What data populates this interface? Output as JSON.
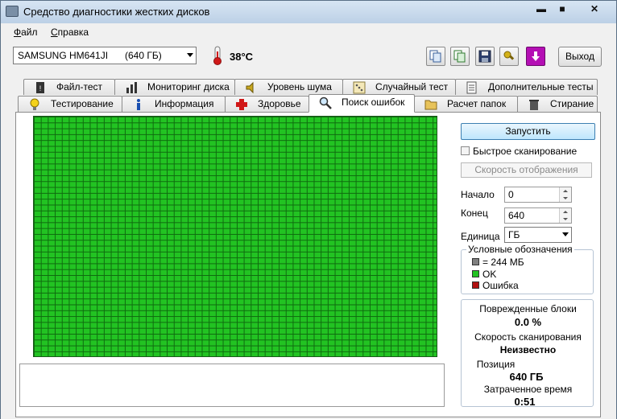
{
  "window": {
    "title": "Средство диагностики жестких дисков",
    "buttons": {
      "minimize": "▬",
      "maximize": "■",
      "close": "✕"
    }
  },
  "menu": {
    "file": {
      "accel": "Ф",
      "rest": "айл"
    },
    "help": {
      "accel": "С",
      "rest": "правка"
    }
  },
  "toolbar": {
    "disk_name": "SAMSUNG HM641JI",
    "disk_capacity": "(640 ГБ)",
    "temperature": "38°C",
    "exit_label": "Выход",
    "icons": [
      "copy-icon",
      "copy-report-icon",
      "save-icon",
      "tools-icon",
      "download-icon"
    ]
  },
  "tabs": {
    "top_row": [
      {
        "label": "Файл-тест",
        "icon": "file-test-icon"
      },
      {
        "label": "Мониторинг диска",
        "icon": "monitor-chart-icon"
      },
      {
        "label": "Уровень шума",
        "icon": "speaker-icon"
      },
      {
        "label": "Случайный тест",
        "icon": "random-test-icon"
      },
      {
        "label": "Дополнительные тесты",
        "icon": "extra-tests-icon"
      }
    ],
    "bottom_row": [
      {
        "label": "Тестирование",
        "icon": "bulb-icon"
      },
      {
        "label": "Информация",
        "icon": "info-icon"
      },
      {
        "label": "Здоровье",
        "icon": "health-cross-icon"
      },
      {
        "label": "Поиск ошибок",
        "icon": "magnifier-icon",
        "active": true
      },
      {
        "label": "Расчет папок",
        "icon": "folder-icon"
      },
      {
        "label": "Стирание",
        "icon": "trash-icon"
      }
    ]
  },
  "scan": {
    "start_label": "Запустить",
    "quick_scan_label": "Быстрое сканирование",
    "quick_scan_checked": false,
    "display_speed_label": "Скорость отображения",
    "start_field_label": "Начало",
    "start_value": "0",
    "end_field_label": "Конец",
    "end_value": "640",
    "units_label": "Единица",
    "units_value": "ГБ"
  },
  "legend": {
    "title": "Условные обозначения",
    "items": [
      {
        "label": "= 244 МБ",
        "color": "#808080"
      },
      {
        "label": "OK",
        "color": "#22c322"
      },
      {
        "label": "Ошибка",
        "color": "#b01010"
      }
    ]
  },
  "stats": {
    "damaged_blocks_label": "Поврежденные блоки",
    "damaged_blocks_value": "0.0 %",
    "scan_speed_label": "Скорость сканирования",
    "scan_speed_value": "Неизвестно",
    "position_label": "Позиция",
    "position_value": "640 ГБ",
    "elapsed_label": "Затраченное время",
    "elapsed_value": "0:51"
  },
  "grid": {
    "status": "all-ok",
    "ok_color": "#22c322"
  }
}
